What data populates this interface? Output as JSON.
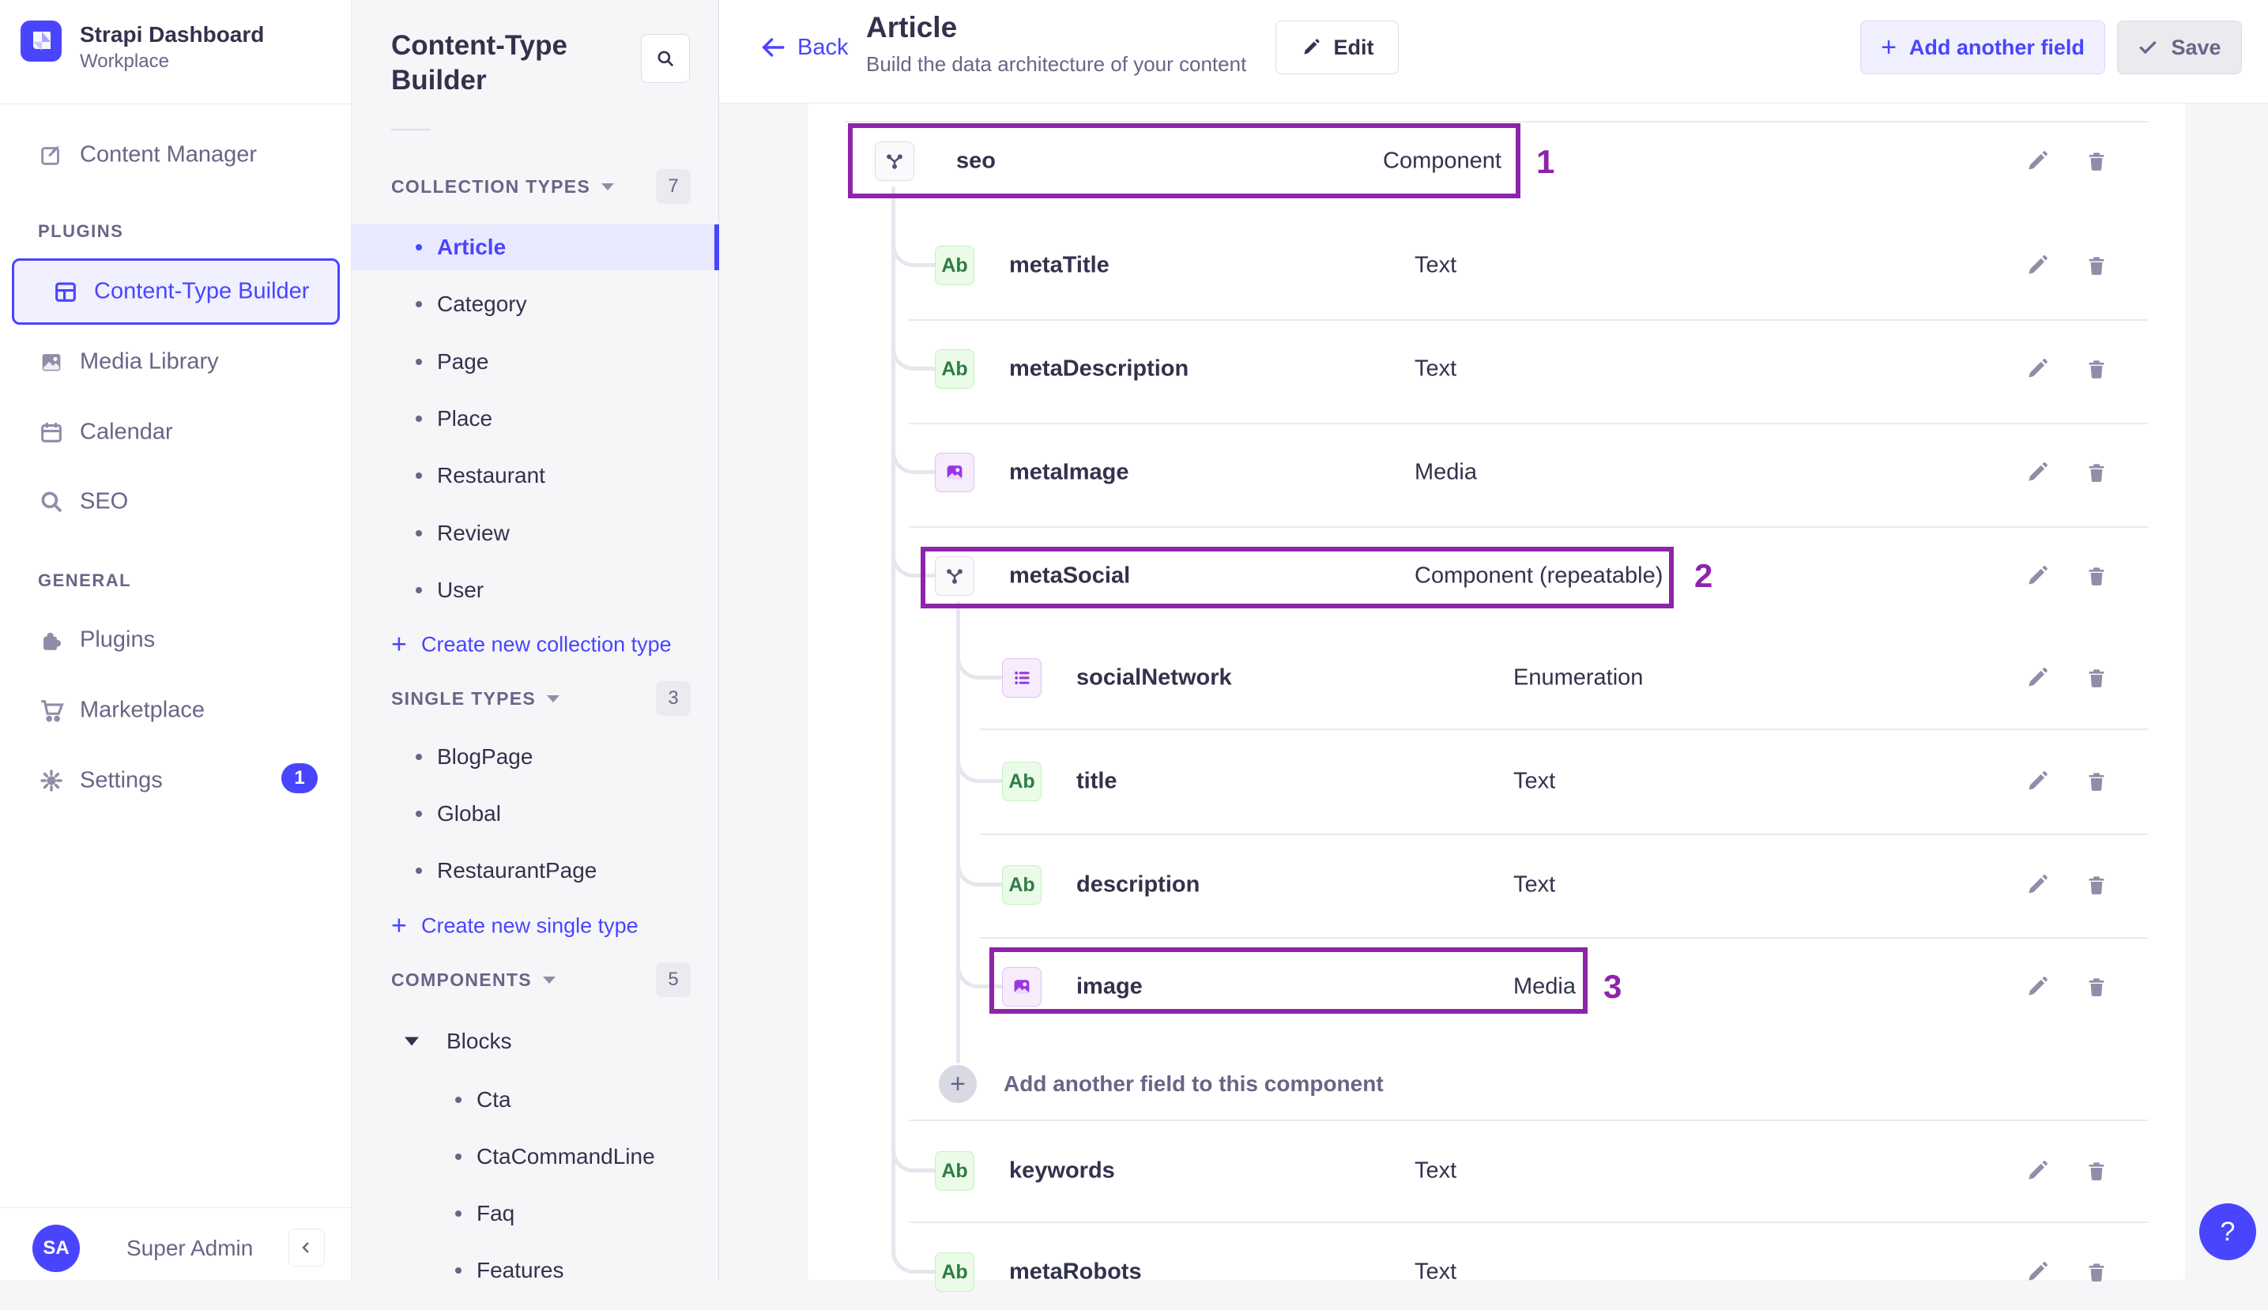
{
  "colors": {
    "accent": "#4945ff",
    "annotation": "#8e24aa",
    "text_icon_green": "#2f7c47",
    "purple_icon": "#9736e8"
  },
  "sidebar": {
    "brand_title": "Strapi Dashboard",
    "brand_subtitle": "Workplace",
    "content_manager": "Content Manager",
    "plugins_label": "PLUGINS",
    "plugins_items": [
      "Content-Type Builder",
      "Media Library",
      "Calendar",
      "SEO"
    ],
    "general_label": "GENERAL",
    "general_items": [
      "Plugins",
      "Marketplace",
      "Settings"
    ],
    "settings_badge": "1",
    "user_initials": "SA",
    "user_name": "Super Admin"
  },
  "builder_nav": {
    "title": "Content-Type Builder",
    "collection_label": "COLLECTION TYPES",
    "collection_count": "7",
    "collection_items": [
      "Article",
      "Category",
      "Page",
      "Place",
      "Restaurant",
      "Review",
      "User"
    ],
    "create_collection": "Create new collection type",
    "single_label": "SINGLE TYPES",
    "single_count": "3",
    "single_items": [
      "BlogPage",
      "Global",
      "RestaurantPage"
    ],
    "create_single": "Create new single type",
    "components_label": "COMPONENTS",
    "components_count": "5",
    "component_group": "Blocks",
    "component_items": [
      "Cta",
      "CtaCommandLine",
      "Faq",
      "Features"
    ]
  },
  "header": {
    "back": "Back",
    "title": "Article",
    "subtitle": "Build the data architecture of your content",
    "edit": "Edit",
    "add_field": "Add another field",
    "save": "Save"
  },
  "fields": [
    {
      "name": "seo",
      "type": "Component"
    },
    {
      "name": "metaTitle",
      "type": "Text"
    },
    {
      "name": "metaDescription",
      "type": "Text"
    },
    {
      "name": "metaImage",
      "type": "Media"
    },
    {
      "name": "metaSocial",
      "type": "Component (repeatable)"
    },
    {
      "name": "socialNetwork",
      "type": "Enumeration"
    },
    {
      "name": "title",
      "type": "Text"
    },
    {
      "name": "description",
      "type": "Text"
    },
    {
      "name": "image",
      "type": "Media"
    },
    {
      "name": "keywords",
      "type": "Text"
    },
    {
      "name": "metaRobots",
      "type": "Text"
    }
  ],
  "add_field_row_label": "Add another field to this component",
  "annotations": {
    "one": "1",
    "two": "2",
    "three": "3"
  },
  "help_label": "?"
}
